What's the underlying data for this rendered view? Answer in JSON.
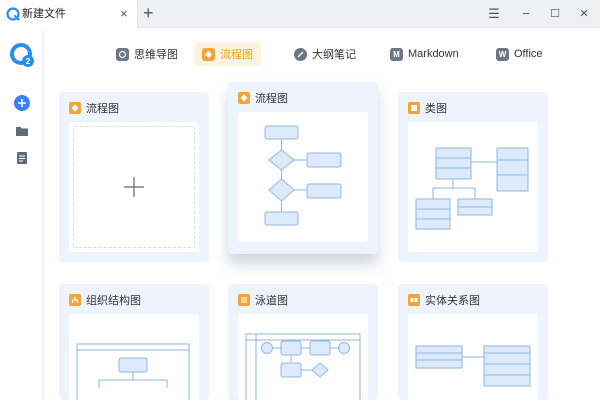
{
  "titlebar": {
    "tab_title": "新建文件",
    "close_glyph": "×",
    "new_tab_glyph": "+",
    "menu_glyph": "☰",
    "minimize_glyph": "−",
    "maximize_glyph": "☐",
    "close_window_glyph": "×"
  },
  "sidebar": {
    "items": [
      {
        "icon": "add-icon"
      },
      {
        "icon": "folder-icon"
      },
      {
        "icon": "document-icon"
      }
    ]
  },
  "type_tabs": [
    {
      "label": "思维导图",
      "icon": "mindmap-icon",
      "active": false
    },
    {
      "label": "流程图",
      "icon": "flowchart-icon",
      "active": true
    },
    {
      "label": "大纲笔记",
      "icon": "outline-icon",
      "active": false
    },
    {
      "label": "Markdown",
      "icon": "markdown-icon",
      "icon_letter": "M",
      "active": false
    },
    {
      "label": "Office",
      "icon": "office-icon",
      "icon_letter": "W",
      "active": false
    }
  ],
  "cards": [
    {
      "title": "流程图",
      "preview": "blank"
    },
    {
      "title": "流程图",
      "preview": "flowchart"
    },
    {
      "title": "类图",
      "preview": "class-diagram"
    },
    {
      "title": "组织结构图",
      "preview": "org-chart"
    },
    {
      "title": "泳道图",
      "preview": "swimlane"
    },
    {
      "title": "实体关系图",
      "preview": "er-diagram"
    }
  ],
  "colors": {
    "accent": "#f0a020",
    "card_bg": "#eef4fd",
    "shape_fill": "#dceafb",
    "shape_stroke": "#8fb6e6",
    "logo_blue": "#2a8ef0"
  }
}
